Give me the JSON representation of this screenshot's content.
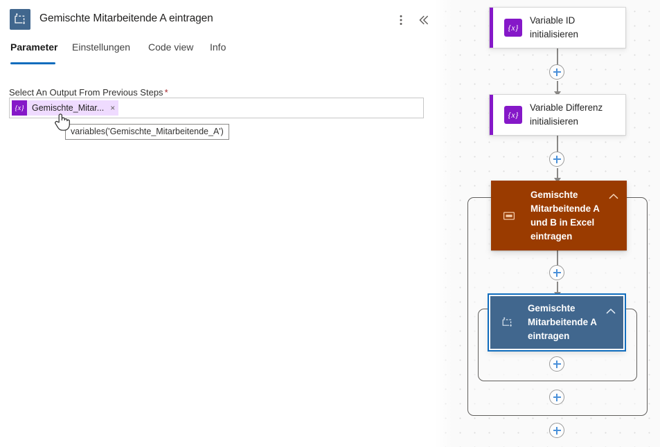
{
  "header": {
    "icon": "action-card-icon",
    "title": "Gemischte Mitarbeitende A eintragen",
    "more_icon": "more-vertical-icon",
    "collapse_icon": "double-chevron-left-icon"
  },
  "tabs": [
    {
      "label": "Parameter",
      "active": true
    },
    {
      "label": "Einstellungen",
      "active": false
    },
    {
      "label": "Code view",
      "active": false
    },
    {
      "label": "Info",
      "active": false
    }
  ],
  "field": {
    "label": "Select An Output From Previous Steps",
    "required_marker": "*",
    "token": {
      "icon": "{x}",
      "text": "Gemischte_Mitar...",
      "remove_icon": "×"
    },
    "tooltip": "variables('Gemischte_Mitarbeitende_A')"
  },
  "flow": {
    "nodes": [
      {
        "id": "variable-id",
        "title": "Variable ID initialisieren",
        "icon": "{x}",
        "kind": "variable",
        "accent": "#8518c8"
      },
      {
        "id": "variable-differenz",
        "title": "Variable Differenz initialisieren",
        "icon": "{x}",
        "kind": "variable",
        "accent": "#8518c8"
      },
      {
        "id": "excel-scope",
        "title": "Gemischte Mitarbeitende A und B in Excel eintragen",
        "icon": "scope-icon",
        "kind": "scope",
        "accent": "#9a3b00",
        "collapse_icon": "chevron-up-icon"
      },
      {
        "id": "mitarbeitende-a",
        "title": "Gemischte Mitarbeitende A eintragen",
        "icon": "action-card-icon",
        "kind": "scope-selected",
        "accent": "#41678e",
        "collapse_icon": "chevron-up-icon",
        "selected": true
      }
    ],
    "add_buttons": [
      {
        "id": "add-after-variable-id",
        "icon": "plus-icon"
      },
      {
        "id": "add-after-variable-differenz",
        "icon": "plus-icon"
      },
      {
        "id": "add-inside-excel-scope",
        "icon": "plus-icon"
      },
      {
        "id": "add-inside-mitarbeitende-a-scope",
        "icon": "plus-icon"
      },
      {
        "id": "add-end-of-excel-scope",
        "icon": "plus-icon"
      },
      {
        "id": "add-after-excel-scope",
        "icon": "plus-icon"
      }
    ]
  },
  "colors": {
    "accent_blue": "#0f6cbd",
    "variable_purple": "#8518c8",
    "scope_brown": "#9a3b00",
    "selected_blue": "#41678e",
    "token_bg": "#efdbff",
    "required_red": "#a4262c"
  }
}
